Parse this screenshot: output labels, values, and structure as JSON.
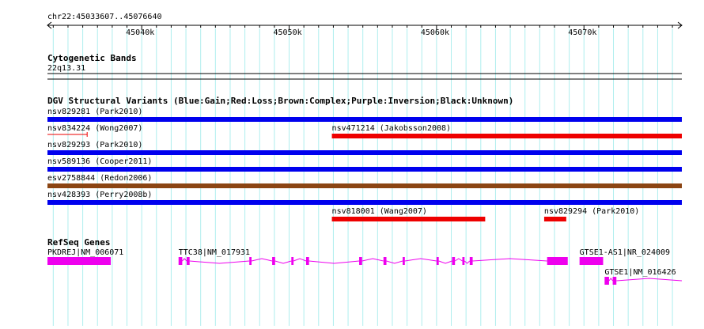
{
  "region": {
    "label": "chr22:45033607..45076640",
    "start": 45033607,
    "end": 45076640
  },
  "ruler": {
    "ticks": [
      {
        "pos": 45040000,
        "label": "45040k"
      },
      {
        "pos": 45050000,
        "label": "45050k"
      },
      {
        "pos": 45060000,
        "label": "45060k"
      },
      {
        "pos": 45070000,
        "label": "45070k"
      }
    ]
  },
  "tracks": {
    "cytoband": {
      "title": "Cytogenetic Bands",
      "band": "22q13.31"
    },
    "dgv": {
      "title": "DGV Structural Variants (Blue:Gain;Red:Loss;Brown:Complex;Purple:Inversion;Black:Unknown)",
      "colors": {
        "gain": "#0000ee",
        "loss": "#ee0000",
        "complex": "#8b4513"
      },
      "features": [
        {
          "label": "nsv829281 (Park2010)",
          "type": "gain",
          "start": 45033607,
          "end": 45076640,
          "row": 0
        },
        {
          "label": "nsv834224 (Wong2007)",
          "type": "loss",
          "start": 45033607,
          "end": 45036300,
          "row": 1,
          "thin": true
        },
        {
          "label": "nsv471214 (Jakobsson2008)",
          "type": "loss",
          "start": 45052900,
          "end": 45076640,
          "row": 1
        },
        {
          "label": "nsv829293 (Park2010)",
          "type": "gain",
          "start": 45033607,
          "end": 45076640,
          "row": 2
        },
        {
          "label": "nsv589136 (Cooper2011)",
          "type": "gain",
          "start": 45033607,
          "end": 45076640,
          "row": 3
        },
        {
          "label": "esv2758844 (Redon2006)",
          "type": "complex",
          "start": 45033607,
          "end": 45076640,
          "row": 4
        },
        {
          "label": "nsv428393 (Perry2008b)",
          "type": "gain",
          "start": 45033607,
          "end": 45076640,
          "row": 5
        },
        {
          "label": "nsv818001 (Wang2007)",
          "type": "loss",
          "start": 45052900,
          "end": 45063300,
          "row": 6
        },
        {
          "label": "nsv829294 (Park2010)",
          "type": "loss",
          "start": 45067300,
          "end": 45068800,
          "row": 6
        }
      ]
    },
    "refseq": {
      "title": "RefSeq Genes",
      "color": "#ee00ee",
      "genes": [
        {
          "label": "PKDREJ|NM_006071",
          "start": 45033607,
          "end": 45037900,
          "row": 0,
          "exons": [
            [
              45033607,
              45037900
            ]
          ]
        },
        {
          "label": "TTC38|NM_017931",
          "start": 45042500,
          "end": 45068900,
          "row": 0,
          "exons": [
            [
              45042500,
              45042750
            ],
            [
              45043050,
              45043250
            ],
            [
              45047300,
              45047450
            ],
            [
              45048850,
              45049050
            ],
            [
              45050150,
              45050300
            ],
            [
              45051150,
              45051350
            ],
            [
              45054750,
              45054950
            ],
            [
              45056400,
              45056600
            ],
            [
              45057700,
              45057850
            ],
            [
              45060000,
              45060150
            ],
            [
              45061050,
              45061250
            ],
            [
              45061750,
              45061900
            ],
            [
              45062250,
              45062450
            ],
            [
              45067500,
              45068900
            ]
          ]
        },
        {
          "label": "GTSE1-AS1|NR_024009",
          "start": 45069700,
          "end": 45071300,
          "row": 0,
          "exons": [
            [
              45069700,
              45071300
            ]
          ]
        },
        {
          "label": "GTSE1|NM_016426",
          "start": 45071400,
          "end": 45076640,
          "row": 1,
          "exons": [
            [
              45071400,
              45071700
            ],
            [
              45071950,
              45072200
            ]
          ]
        }
      ]
    }
  }
}
